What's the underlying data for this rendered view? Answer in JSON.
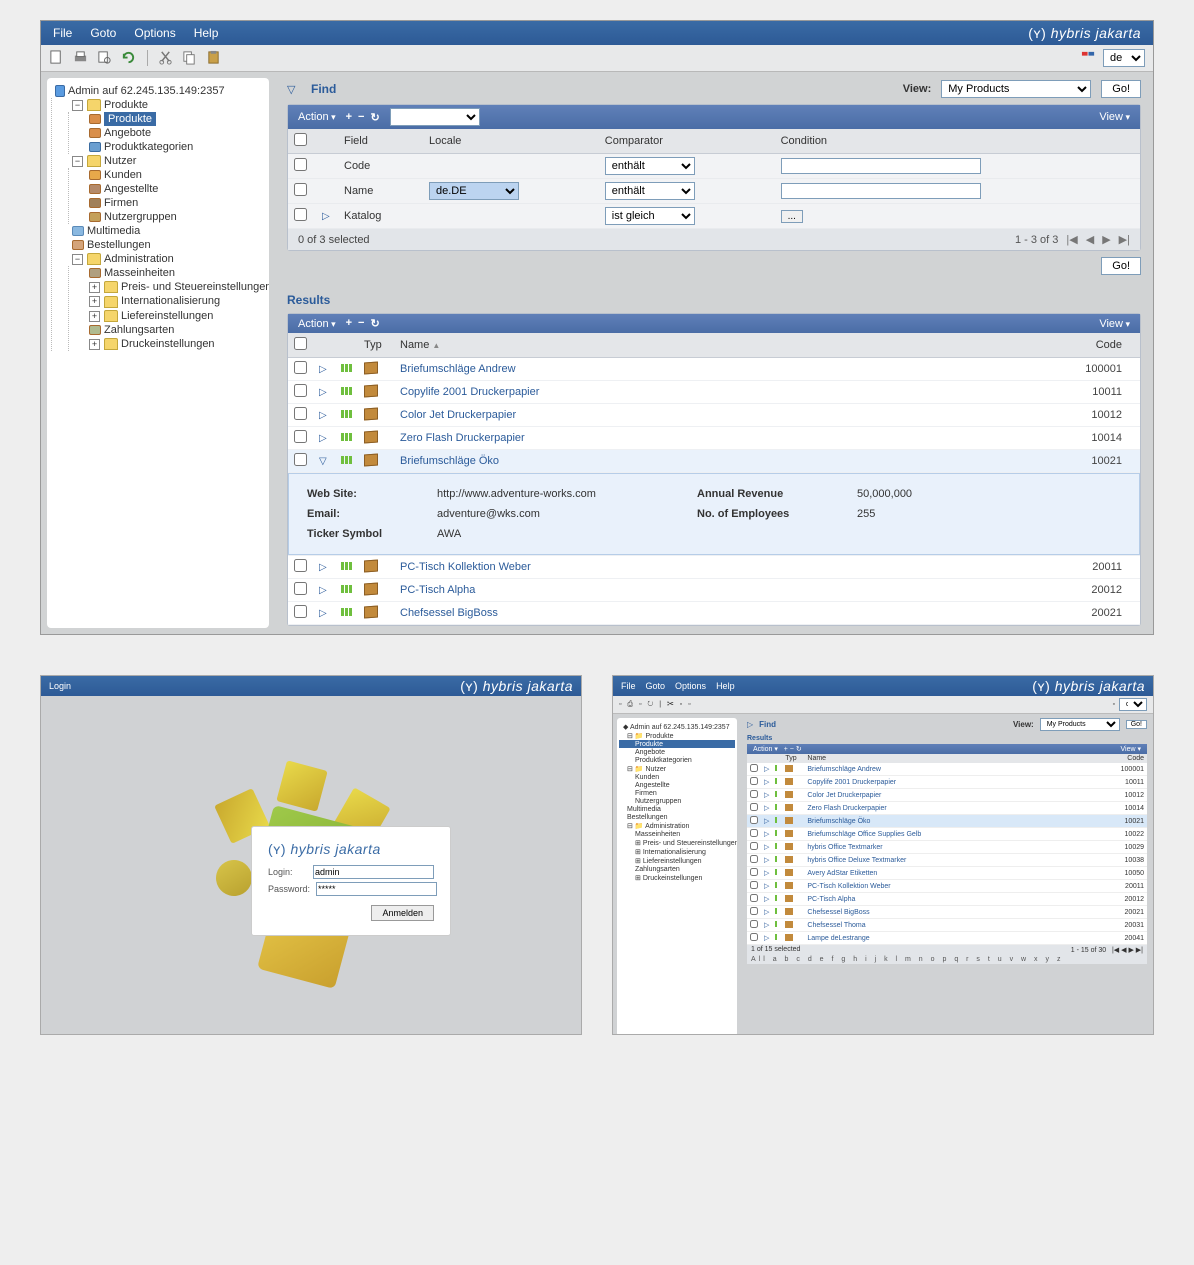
{
  "menubar": {
    "file": "File",
    "goto": "Goto",
    "options": "Options",
    "help": "Help"
  },
  "brand": "hybris jakarta",
  "locale_select": "de",
  "tree": {
    "root": "Admin auf 62.245.135.149:2357",
    "produkte": {
      "label": "Produkte",
      "items": [
        "Produkte",
        "Angebote",
        "Produktkategorien"
      ]
    },
    "nutzer": {
      "label": "Nutzer",
      "items": [
        "Kunden",
        "Angestellte",
        "Firmen",
        "Nutzergruppen"
      ]
    },
    "multimedia": "Multimedia",
    "bestellungen": "Bestellungen",
    "admin": {
      "label": "Administration",
      "items": [
        "Masseinheiten",
        "Preis- und Steuereinstellungen",
        "Internationalisierung",
        "Liefereinstellungen",
        "Zahlungsarten",
        "Druckeinstellungen"
      ]
    }
  },
  "find": {
    "title": "Find",
    "view_label": "View:",
    "view_value": "My Products",
    "go": "Go!",
    "action": "Action",
    "view_menu": "View",
    "headers": {
      "field": "Field",
      "locale": "Locale",
      "comparator": "Comparator",
      "condition": "Condition"
    },
    "rows": [
      {
        "field": "Code",
        "locale": "",
        "comparator": "enthält",
        "condition": ""
      },
      {
        "field": "Name",
        "locale": "de.DE",
        "comparator": "enthält",
        "condition": ""
      },
      {
        "field": "Katalog",
        "locale": "",
        "comparator": "ist gleich",
        "condition_btn": "..."
      }
    ],
    "status": "0 of 3 selected",
    "pager": "1 - 3  of 3"
  },
  "results": {
    "title": "Results",
    "headers": {
      "typ": "Typ",
      "name": "Name",
      "code": "Code"
    },
    "rows": [
      {
        "name": "Briefumschläge Andrew",
        "code": "100001"
      },
      {
        "name": "Copylife 2001 Druckerpapier",
        "code": "10011"
      },
      {
        "name": "Color Jet Druckerpapier",
        "code": "10012"
      },
      {
        "name": "Zero Flash Druckerpapier",
        "code": "10014"
      },
      {
        "name": "Briefumschläge Öko",
        "code": "10021",
        "expanded": true
      },
      {
        "name": "PC-Tisch Kollektion Weber",
        "code": "20011"
      },
      {
        "name": "PC-Tisch Alpha",
        "code": "20012"
      },
      {
        "name": "Chefsessel BigBoss",
        "code": "20021"
      }
    ],
    "detail": {
      "website_label": "Web Site:",
      "website": "http://www.adventure-works.com",
      "email_label": "Email:",
      "email": "adventure@wks.com",
      "ticker_label": "Ticker Symbol",
      "ticker": "AWA",
      "revenue_label": "Annual Revenue",
      "revenue": "50,000,000",
      "employees_label": "No. of Employees",
      "employees": "255"
    }
  },
  "login": {
    "title": "Login",
    "login_label": "Login:",
    "login_value": "admin",
    "password_label": "Password:",
    "password_value": "*****",
    "submit": "Anmelden"
  },
  "mini": {
    "find": "Find",
    "view_label": "View:",
    "view_value": "My Products",
    "go": "Go!",
    "results": "Results",
    "action": "Action",
    "view_menu": "View",
    "headers": {
      "typ": "Typ",
      "name": "Name",
      "code": "Code"
    },
    "rows": [
      {
        "name": "Briefumschläge Andrew",
        "code": "100001"
      },
      {
        "name": "Copylife 2001 Druckerpapier",
        "code": "10011"
      },
      {
        "name": "Color Jet Druckerpapier",
        "code": "10012"
      },
      {
        "name": "Zero Flash Druckerpapier",
        "code": "10014"
      },
      {
        "name": "Briefumschläge Öko",
        "code": "10021"
      },
      {
        "name": "Briefumschläge Office Supplies Gelb",
        "code": "10022"
      },
      {
        "name": "hybris Office Textmarker",
        "code": "10029"
      },
      {
        "name": "hybris Office Deluxe Textmarker",
        "code": "10038"
      },
      {
        "name": "Avery AdStar Etiketten",
        "code": "10050"
      },
      {
        "name": "PC-Tisch Kollektion Weber",
        "code": "20011"
      },
      {
        "name": "PC-Tisch Alpha",
        "code": "20012"
      },
      {
        "name": "Chefsessel BigBoss",
        "code": "20021"
      },
      {
        "name": "Chefsessel Thoma",
        "code": "20031"
      },
      {
        "name": "Lampe deLestrange",
        "code": "20041"
      }
    ],
    "status": "1 of 15 selected",
    "pager": "1 - 15 of 30",
    "alphabet": "All a b c d e f g h i j k l m n o p q r s t u v w x y z"
  }
}
